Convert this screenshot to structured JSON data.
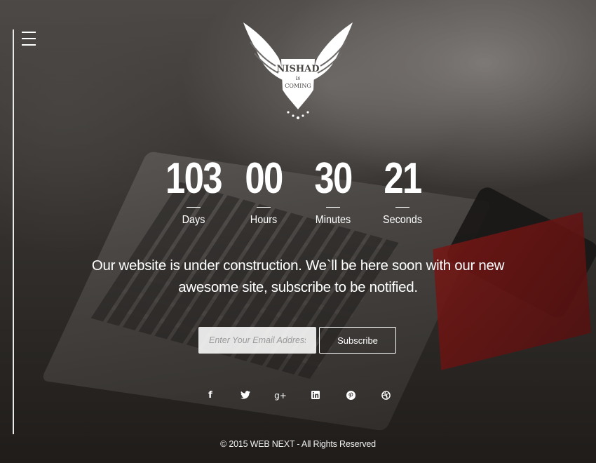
{
  "logo": {
    "line1": "NISHAD",
    "line2": "is",
    "line3": "COMING"
  },
  "countdown": [
    {
      "value": "103",
      "label": "Days"
    },
    {
      "value": "00",
      "label": "Hours"
    },
    {
      "value": "30",
      "label": "Minutes"
    },
    {
      "value": "21",
      "label": "Seconds"
    }
  ],
  "tagline": {
    "line1": "Our website is under construction. We`ll be here soon with our new",
    "line2": "awesome site, subscribe to be notified."
  },
  "subscribe": {
    "placeholder": "Enter Your Email Address",
    "button_label": "Subscribe"
  },
  "social": [
    {
      "icon": "facebook-icon",
      "glyph": "f"
    },
    {
      "icon": "twitter-icon",
      "glyph": ""
    },
    {
      "icon": "google-plus-icon",
      "glyph": "g+"
    },
    {
      "icon": "linkedin-icon",
      "glyph": ""
    },
    {
      "icon": "pinterest-icon",
      "glyph": ""
    },
    {
      "icon": "dribbble-icon",
      "glyph": ""
    }
  ],
  "footer": {
    "copyright": "© 2015 WEB NEXT - All Rights Reserved"
  },
  "colors": {
    "text": "#ffffff",
    "notebook_accent": "#b41a18"
  }
}
